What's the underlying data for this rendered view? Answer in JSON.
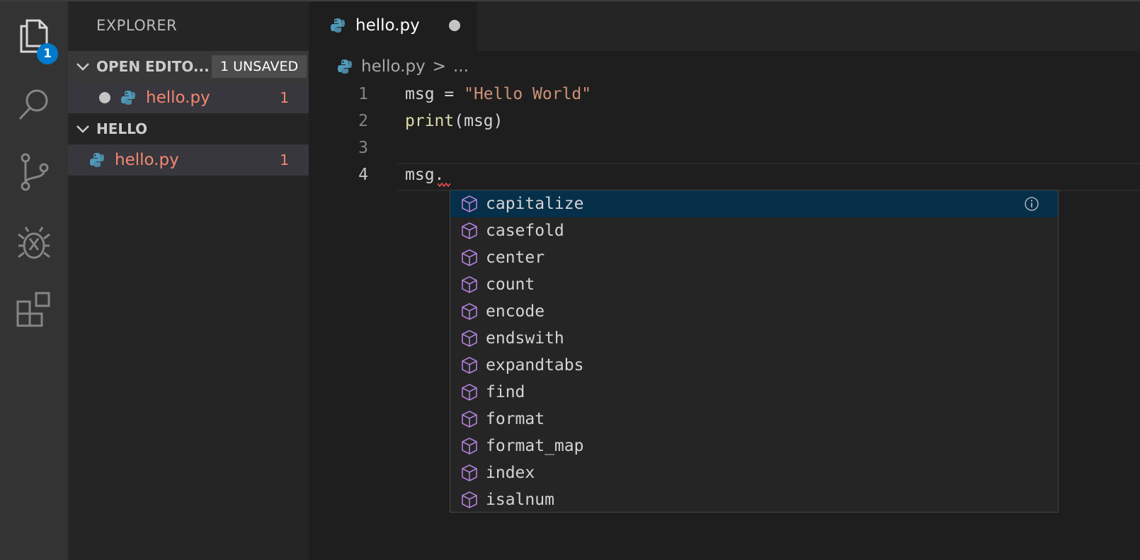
{
  "activity_bar": {
    "explorer_badge": "1",
    "items": [
      "files-icon",
      "search-icon",
      "source-control-icon",
      "debug-icon",
      "extensions-icon"
    ]
  },
  "sidebar": {
    "title": "EXPLORER",
    "open_editors": {
      "label": "OPEN EDITO...",
      "unsaved_badge": "1 UNSAVED",
      "files": [
        {
          "name": "hello.py",
          "problems": "1"
        }
      ]
    },
    "folder": {
      "label": "HELLO",
      "files": [
        {
          "name": "hello.py",
          "problems": "1"
        }
      ]
    }
  },
  "tab": {
    "label": "hello.py"
  },
  "breadcrumb": {
    "file": "hello.py",
    "sep": ">",
    "rest": "..."
  },
  "editor": {
    "line_numbers": [
      "1",
      "2",
      "3",
      "4"
    ],
    "line1": {
      "var": "msg = ",
      "str": "\"Hello World\""
    },
    "line2": {
      "fn": "print",
      "args": "(msg)"
    },
    "line4": "msg."
  },
  "suggestions": [
    "capitalize",
    "casefold",
    "center",
    "count",
    "encode",
    "endswith",
    "expandtabs",
    "find",
    "format",
    "format_map",
    "index",
    "isalnum"
  ],
  "colors": {
    "accent": "#007acc",
    "error": "#f48771",
    "selection": "#062f4a",
    "method_icon": "#b180d7"
  }
}
